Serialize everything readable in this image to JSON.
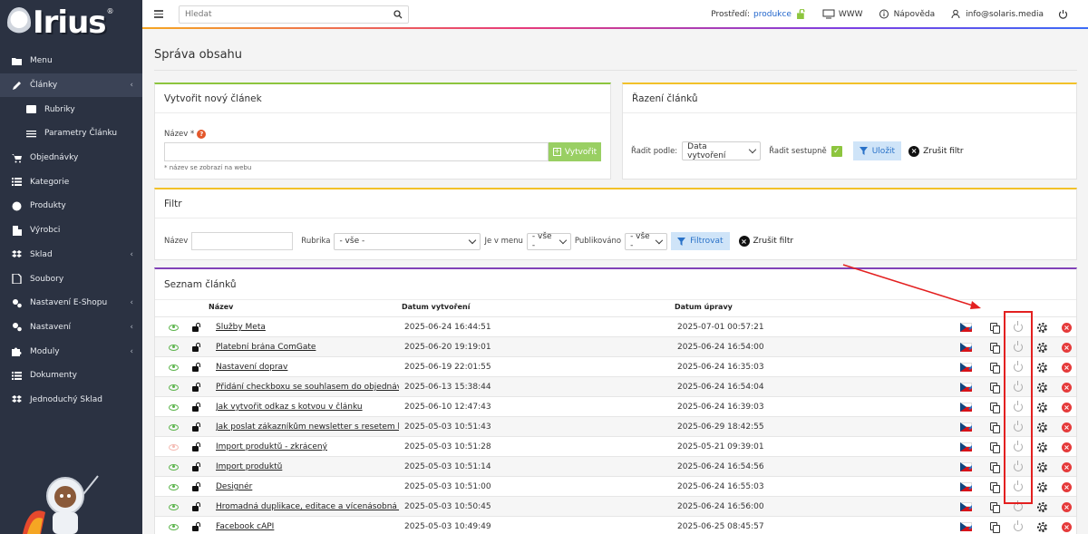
{
  "brand": {
    "logo_text": "Irius",
    "reg": "®"
  },
  "sidebar": {
    "items": [
      {
        "label": "Menu",
        "icon": "folder-icon"
      },
      {
        "label": "Články",
        "icon": "pencil-icon",
        "active": true,
        "has_chevron": true
      },
      {
        "label": "Rubriky",
        "icon": "list-alt-icon",
        "sub": true
      },
      {
        "label": "Parametry Článku",
        "icon": "sliders-icon",
        "sub": true
      },
      {
        "label": "Objednávky",
        "icon": "cart-icon"
      },
      {
        "label": "Kategorie",
        "icon": "list-icon"
      },
      {
        "label": "Produkty",
        "icon": "globe-icon"
      },
      {
        "label": "Výrobci",
        "icon": "building-icon"
      },
      {
        "label": "Sklad",
        "icon": "dropbox-icon",
        "has_chevron": true
      },
      {
        "label": "Soubory",
        "icon": "file-icon"
      },
      {
        "label": "Nastavení E-Shopu",
        "icon": "cogs-icon",
        "has_chevron": true
      },
      {
        "label": "Nastavení",
        "icon": "cogs-icon",
        "has_chevron": true
      },
      {
        "label": "Moduly",
        "icon": "puzzle-icon",
        "has_chevron": true
      },
      {
        "label": "Dokumenty",
        "icon": "list-icon"
      },
      {
        "label": "Jednoduchý Sklad",
        "icon": "dropbox-icon"
      }
    ]
  },
  "topbar": {
    "search_placeholder": "Hledat",
    "env_label": "Prostředí:",
    "env_value": "produkce",
    "www_label": "WWW",
    "help_label": "Nápověda",
    "user_email": "info@solaris.media"
  },
  "page": {
    "title": "Správa obsahu"
  },
  "create_card": {
    "title": "Vytvořit nový článek",
    "name_label": "Název *",
    "help_icon_text": "?",
    "button_label": "Vytvořit",
    "hint": "* název se zobrazí na webu"
  },
  "sort_card": {
    "title": "Řazení článků",
    "sort_by_label": "Řadit podle:",
    "sort_by_value": "Data vytvoření",
    "desc_label": "Řadit sestupně",
    "save_label": "Uložit",
    "clear_label": "Zrušit filtr"
  },
  "filter_card": {
    "title": "Filtr",
    "name_label": "Název",
    "category_label": "Rubrika",
    "category_value": "- vše -",
    "in_menu_label": "Je v menu",
    "in_menu_value": "- vše -",
    "published_label": "Publikováno",
    "published_value": "- vše -",
    "filter_label": "Filtrovat",
    "clear_label": "Zrušit filtr"
  },
  "list_card": {
    "title": "Seznam článků",
    "columns": {
      "name": "Název",
      "created": "Datum vytvoření",
      "updated": "Datum úpravy"
    },
    "rows": [
      {
        "name": "Služby Meta",
        "created": "2025-06-24 16:44:51",
        "updated": "2025-07-01 00:57:21",
        "visible": true
      },
      {
        "name": "Platební brána ComGate",
        "created": "2025-06-20 19:19:01",
        "updated": "2025-06-24 16:54:00",
        "visible": true
      },
      {
        "name": "Nastavení doprav",
        "created": "2025-06-19 22:01:55",
        "updated": "2025-06-24 16:35:03",
        "visible": true
      },
      {
        "name": "Přidání checkboxu se souhlasem do objednávky",
        "created": "2025-06-13 15:38:44",
        "updated": "2025-06-24 16:54:04",
        "visible": true
      },
      {
        "name": "Jak vytvořit odkaz s kotvou v článku",
        "created": "2025-06-10 12:47:43",
        "updated": "2025-06-24 16:39:03",
        "visible": true
      },
      {
        "name": "Jak poslat zákazníkům newsletter s resetem hesla",
        "created": "2025-05-03 10:51:43",
        "updated": "2025-06-29 18:42:55",
        "visible": true
      },
      {
        "name": "Import produktů - zkrácený",
        "created": "2025-05-03 10:51:28",
        "updated": "2025-05-21 09:39:01",
        "visible": false
      },
      {
        "name": "Import produktů",
        "created": "2025-05-03 10:51:14",
        "updated": "2025-06-24 16:54:56",
        "visible": true
      },
      {
        "name": "Designér",
        "created": "2025-05-03 10:51:00",
        "updated": "2025-06-24 16:55:03",
        "visible": true
      },
      {
        "name": "Hromadná duplikace, editace a vícenásobná hromadná úprava",
        "created": "2025-05-03 10:50:45",
        "updated": "2025-06-24 16:56:00",
        "visible": true
      },
      {
        "name": "Facebook cAPI",
        "created": "2025-05-03 10:49:49",
        "updated": "2025-06-25 08:45:57",
        "visible": true
      }
    ]
  },
  "colors": {
    "sidebar_bg": "#2b3242",
    "accent_green": "#8dc53e",
    "accent_yellow": "#f2c129",
    "accent_purple": "#8142b8",
    "link_blue": "#2266cc",
    "annotation_red": "#e32020"
  }
}
